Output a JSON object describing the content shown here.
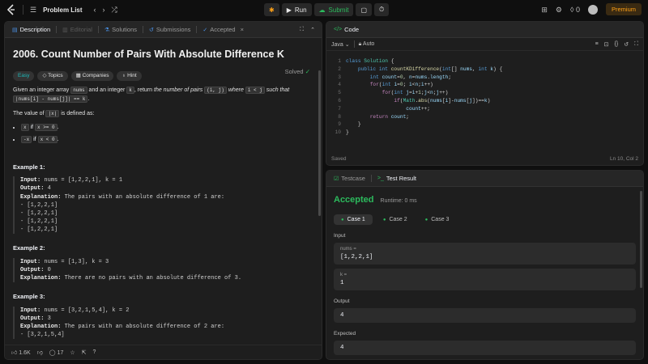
{
  "topbar": {
    "problem_list": "Problem List",
    "run": "Run",
    "submit": "Submit",
    "notif_count": "0",
    "premium": "Premium"
  },
  "desc_tabs": {
    "description": "Description",
    "editorial": "Editorial",
    "solutions": "Solutions",
    "submissions": "Submissions",
    "accepted": "Accepted"
  },
  "problem": {
    "title": "2006. Count Number of Pairs With Absolute Difference K",
    "solved": "Solved",
    "chips": {
      "easy": "Easy",
      "topics": "Topics",
      "companies": "Companies",
      "hint": "Hint"
    },
    "p1_a": "Given an integer array ",
    "p1_nums": "nums",
    "p1_b": " and an integer ",
    "p1_k": "k",
    "p1_c": ", return ",
    "p1_d": "the number of pairs ",
    "p1_ij": "(i, j)",
    "p1_e": " where ",
    "p1_iltj": "i < j",
    "p1_f": " such that ",
    "p1_cond": "|nums[i] - nums[j]| == k",
    "p1_g": ".",
    "p2_a": "The value of ",
    "p2_code": "|x|",
    "p2_b": " is defined as:",
    "b1_code": "x",
    "b1_if": " if ",
    "b1_cond": "x >= 0",
    "b1_end": ".",
    "b2_code": "-x",
    "b2_if": " if ",
    "b2_cond": "x < 0",
    "b2_end": ".",
    "ex1_h": "Example 1:",
    "ex1_in_l": "Input:",
    "ex1_in": " nums = [1,2,2,1], k = 1",
    "ex1_out_l": "Output:",
    "ex1_out": " 4",
    "ex1_exp_l": "Explanation:",
    "ex1_exp": " The pairs with an absolute difference of 1 are:",
    "ex1_pairs": [
      "- [1,2,2,1]",
      "- [1,2,2,1]",
      "- [1,2,2,1]",
      "- [1,2,2,1]"
    ],
    "ex2_h": "Example 2:",
    "ex2_in_l": "Input:",
    "ex2_in": " nums = [1,3], k = 3",
    "ex2_out_l": "Output:",
    "ex2_out": " 0",
    "ex2_exp_l": "Explanation:",
    "ex2_exp": " There are no pairs with an absolute difference of 3.",
    "ex3_h": "Example 3:",
    "ex3_in_l": "Input:",
    "ex3_in": " nums = [3,2,1,5,4], k = 2",
    "ex3_out_l": "Output:",
    "ex3_out": " 3",
    "ex3_exp_l": "Explanation:",
    "ex3_exp": " The pairs with an absolute difference of 2 are:",
    "ex3_pair1": "- [3,2,1,5,4]"
  },
  "desc_footer": {
    "likes": "1.6K",
    "comments": "17"
  },
  "code_panel": {
    "title": "Code",
    "language": "Java",
    "auto": "Auto",
    "saved": "Saved",
    "cursor": "Ln 10, Col 2"
  },
  "result_panel": {
    "testcase_tab": "Testcase",
    "result_tab": "Test Result",
    "status": "Accepted",
    "runtime": "Runtime: 0 ms",
    "cases": [
      "Case 1",
      "Case 2",
      "Case 3"
    ],
    "input_label": "Input",
    "nums_label": "nums =",
    "nums_value": "[1,2,2,1]",
    "k_label": "k =",
    "k_value": "1",
    "output_label": "Output",
    "output_value": "4",
    "expected_label": "Expected",
    "expected_value": "4"
  },
  "colors": {
    "accent": "#ffa116",
    "success": "#2cbb5d",
    "easy": "#1cbaba"
  },
  "icons": [
    "logo-icon",
    "list-icon",
    "chevron-left-icon",
    "chevron-right-icon",
    "shuffle-icon",
    "debug-icon",
    "play-icon",
    "upload-icon",
    "note-icon",
    "timer-icon",
    "grid-icon",
    "gear-icon",
    "fire-icon",
    "avatar"
  ]
}
